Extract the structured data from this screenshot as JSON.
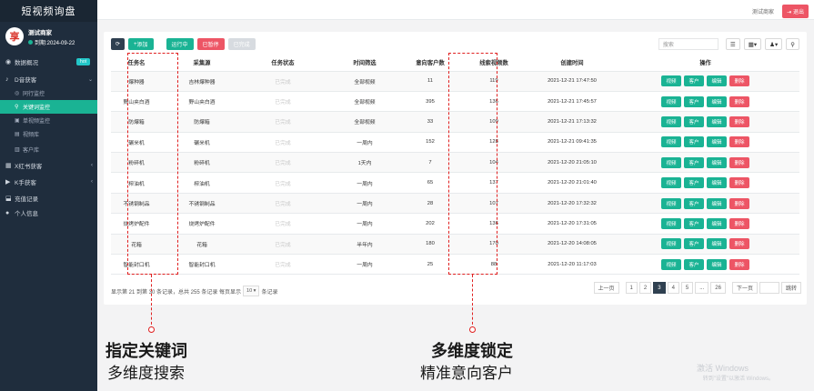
{
  "sidebar": {
    "title": "短视频询盘",
    "user": {
      "avatar_text": "享",
      "name": "测试商家",
      "expire": "到期:2024-09-22"
    },
    "menu": [
      {
        "label": "数据概况",
        "icon": "dashboard-icon",
        "badge": "hot"
      },
      {
        "label": "D音获客",
        "icon": "douyin-icon",
        "open": true
      },
      {
        "label": "同行监控",
        "icon": "circle-icon",
        "sub": true
      },
      {
        "label": "关键词监控",
        "icon": "search-icon",
        "sub": true,
        "active": true
      },
      {
        "label": "单视频监控",
        "icon": "video-icon",
        "sub": true
      },
      {
        "label": "视频库",
        "icon": "library-icon",
        "sub": true
      },
      {
        "label": "客户库",
        "icon": "customer-icon",
        "sub": true
      },
      {
        "label": "X红书获客",
        "icon": "book-icon"
      },
      {
        "label": "K手获客",
        "icon": "kuaishou-icon"
      },
      {
        "label": "充值记录",
        "icon": "recharge-icon"
      },
      {
        "label": "个人信息",
        "icon": "user-icon"
      }
    ]
  },
  "topbar": {
    "merchant": "测试商家",
    "logout": "退出"
  },
  "toolbar": {
    "add": "添加",
    "running": "运行中",
    "paused": "已暂停",
    "done": "已完成"
  },
  "search": {
    "placeholder": "搜索"
  },
  "table": {
    "headers": [
      "任务名",
      "采集源",
      "任务状态",
      "时间筛选",
      "意向客户数",
      "线索视频数",
      "创建时间",
      "操作"
    ],
    "actions": [
      "视频",
      "客户",
      "编辑",
      "删除"
    ],
    "rows": [
      {
        "name": "爆种器",
        "source": "吉林爆种器",
        "status": "已完成",
        "filter": "全部视频",
        "intent": "11",
        "videos": "119",
        "created": "2021-12-21 17:47:50"
      },
      {
        "name": "野山夹白酒",
        "source": "野山夹白酒",
        "status": "已完成",
        "filter": "全部视频",
        "intent": "395",
        "videos": "136",
        "created": "2021-12-21 17:45:57"
      },
      {
        "name": "防爆箱",
        "source": "防爆箱",
        "status": "已完成",
        "filter": "全部视频",
        "intent": "33",
        "videos": "109",
        "created": "2021-12-21 17:13:32"
      },
      {
        "name": "碾米机",
        "source": "碾米机",
        "status": "已完成",
        "filter": "一周内",
        "intent": "152",
        "videos": "128",
        "created": "2021-12-21 09:41:35"
      },
      {
        "name": "粉碎机",
        "source": "粉碎机",
        "status": "已完成",
        "filter": "1天内",
        "intent": "7",
        "videos": "104",
        "created": "2021-12-20 21:05:10"
      },
      {
        "name": "榨油机",
        "source": "榨油机",
        "status": "已完成",
        "filter": "一周内",
        "intent": "65",
        "videos": "137",
        "created": "2021-12-20 21:01:40"
      },
      {
        "name": "不锈钢制品",
        "source": "不锈钢制品",
        "status": "已完成",
        "filter": "一周内",
        "intent": "28",
        "videos": "107",
        "created": "2021-12-20 17:32:32"
      },
      {
        "name": "烧烤炉配件",
        "source": "烧烤炉配件",
        "status": "已完成",
        "filter": "一周内",
        "intent": "202",
        "videos": "136",
        "created": "2021-12-20 17:31:05"
      },
      {
        "name": "花箱",
        "source": "花箱",
        "status": "已完成",
        "filter": "半年内",
        "intent": "180",
        "videos": "170",
        "created": "2021-12-20 14:08:05"
      },
      {
        "name": "智能封口机",
        "source": "智能封口机",
        "status": "已完成",
        "filter": "一周内",
        "intent": "25",
        "videos": "88",
        "created": "2021-12-20 11:17:03"
      }
    ]
  },
  "footer": {
    "info_prefix": "显示第 21 到第 30 条记录，总共 255 条记录 每页显示",
    "page_size": "10",
    "info_suffix": "条记录",
    "pages": [
      "上一页",
      "1",
      "2",
      "3",
      "4",
      "5",
      "...",
      "26",
      "下一页"
    ],
    "active_page": "3",
    "jump": "跳转"
  },
  "captions": {
    "left_title": "指定关键词",
    "left_sub": "多维度搜索",
    "right_title": "多维度锁定",
    "right_sub": "精准意向客户"
  },
  "watermark": {
    "line1": "激活 Windows",
    "line2": "转到\"设置\"以激活 Windows。"
  },
  "colors": {
    "accent": "#1ab394",
    "danger": "#ed5565",
    "sidebar": "#1f2d3d",
    "highlight": "#e02020"
  }
}
